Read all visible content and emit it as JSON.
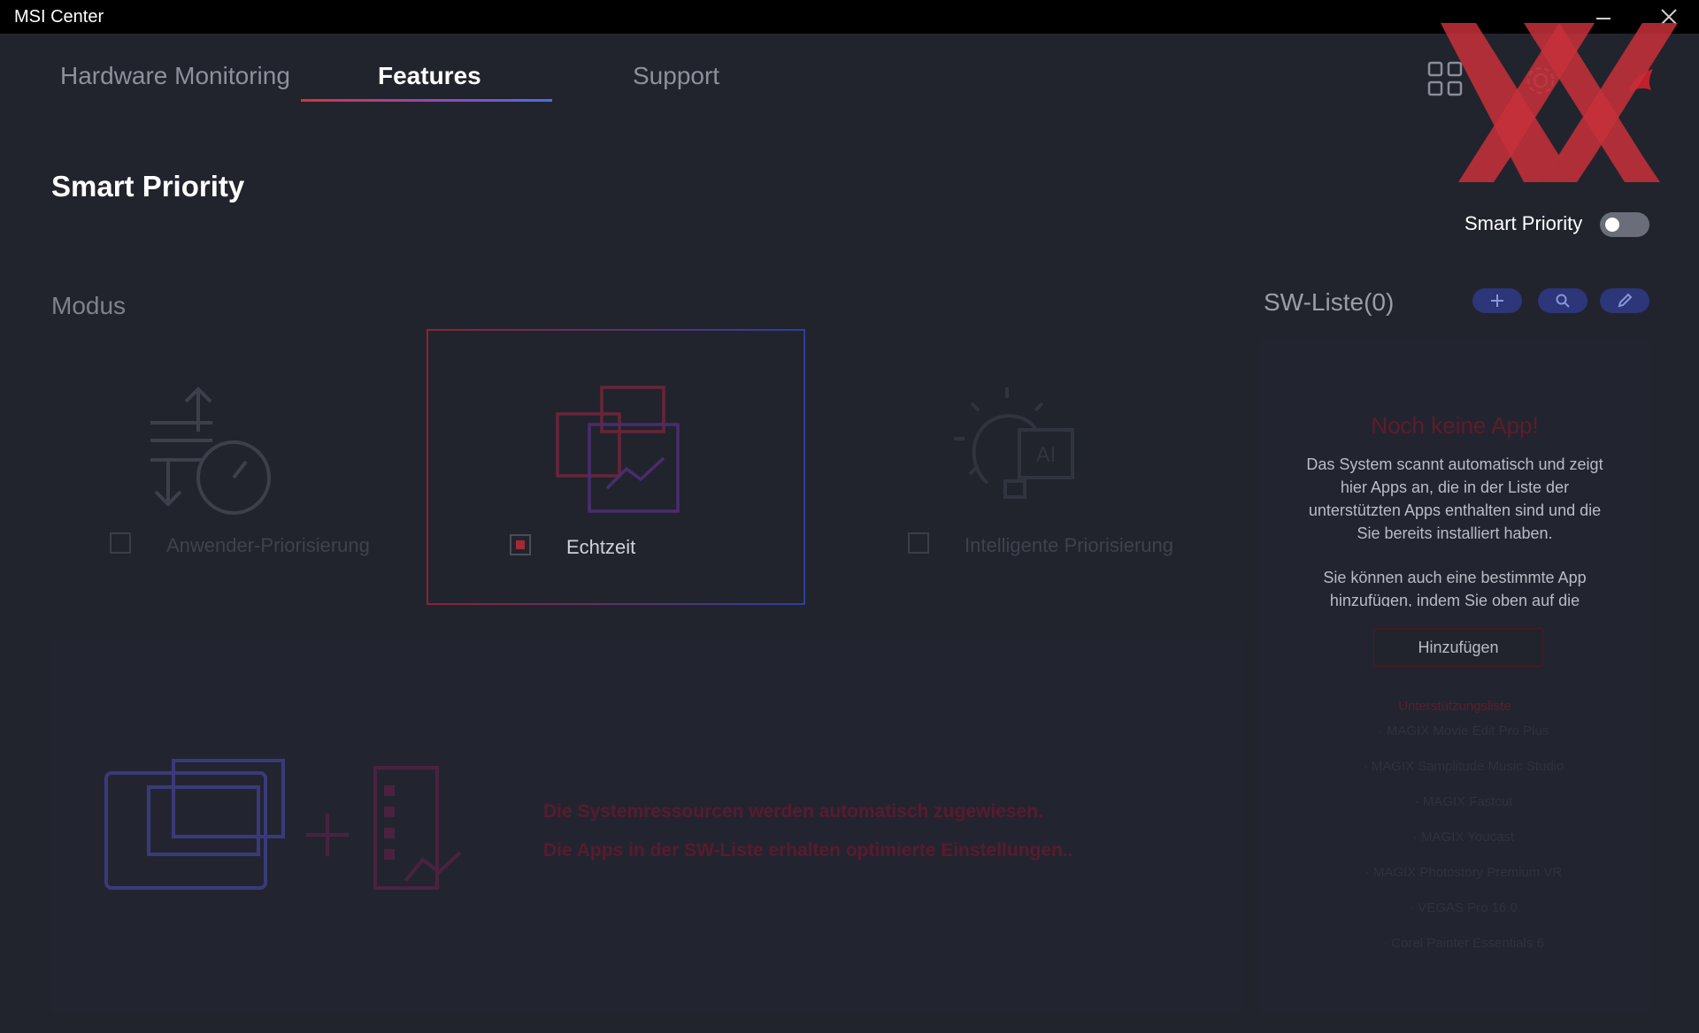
{
  "window": {
    "title": "MSI Center"
  },
  "tabs": [
    {
      "label": "Hardware Monitoring",
      "active": false
    },
    {
      "label": "Features",
      "active": true
    },
    {
      "label": "Support",
      "active": false
    }
  ],
  "icons": {
    "grid": "grid-icon",
    "settings": "gear-icon",
    "dragon": "msi-dragon-icon",
    "minimize": "minimize-icon",
    "close": "close-icon"
  },
  "page": {
    "title": "Smart Priority",
    "toggle_label": "Smart Priority",
    "toggle_on": false
  },
  "mode": {
    "label": "Modus",
    "options": [
      {
        "label": "Anwender-Priorisierung",
        "selected": false
      },
      {
        "label": "Echtzeit",
        "selected": true
      },
      {
        "label": "Intelligente Priorisierung",
        "selected": false
      }
    ]
  },
  "info": {
    "line1": "Die Systemressourcen werden automatisch zugewiesen.",
    "line2": "Die Apps in der SW-Liste erhalten optimierte Einstellungen.."
  },
  "sw_list": {
    "title": "SW-Liste(0)",
    "empty_title": "Noch keine App!",
    "desc1": "Das System scannt automatisch und zeigt hier Apps an, die in der Liste der unterstützten Apps enthalten sind und die Sie bereits installiert haben.",
    "desc2": "Sie können auch eine bestimmte App hinzufügen, indem Sie oben auf die Schaltfläche Hinzufügen klicken.",
    "add_button": "Hinzufügen",
    "support_title": "Unterstützungsliste",
    "support_items": [
      "· MAGIX Movie Edit Pro Plus",
      "· MAGIX Samplitude Music Studio",
      "· MAGIX Fastcut",
      "· MAGIX Youcast",
      "· MAGIX Photostory Premium VR",
      "· VEGAS Pro 16.0",
      "· Corel Painter Essentials 6"
    ]
  },
  "colors": {
    "background": "#21242d",
    "accent_red": "#d8323b",
    "accent_blue": "#4d6de0"
  }
}
